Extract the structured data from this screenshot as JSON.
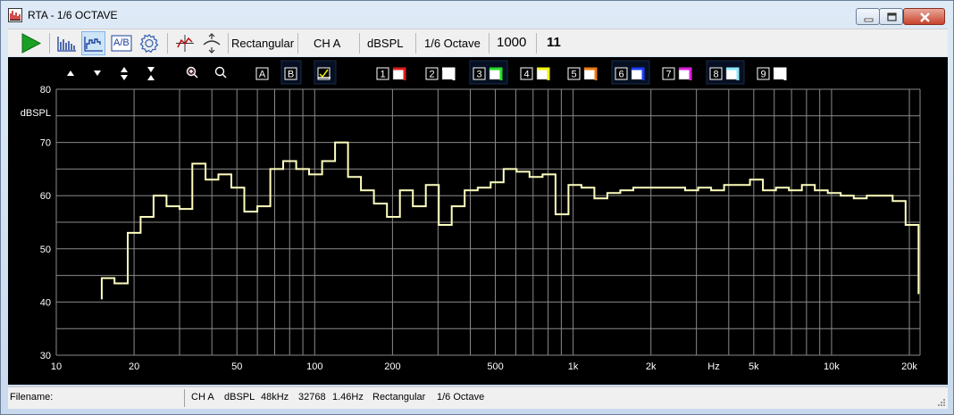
{
  "window": {
    "title": "RTA - 1/6 OCTAVE"
  },
  "toolbar": {
    "icons": [
      "play-icon",
      "bar-graph-icon",
      "line-graph-icon",
      "ab-compare-icon",
      "gear-icon",
      "cursor-icon",
      "cursor-track-icon"
    ],
    "ab_label": "A/B",
    "window_type": "Rectangular",
    "channel": "CH A",
    "units": "dBSPL",
    "resolution": "1/6 Octave",
    "averages": "1000",
    "count": "11"
  },
  "graph_controls": {
    "nav_icons": [
      "arrow-up-icon",
      "arrow-down-icon",
      "expand-vertical-icon",
      "collapse-vertical-icon",
      "zoom-in-icon",
      "zoom-out-icon"
    ],
    "trace_a": "A",
    "trace_b": "B",
    "memories": [
      {
        "num": "1",
        "color": "#e11b1b"
      },
      {
        "num": "2",
        "color": "#ffffff"
      },
      {
        "num": "3",
        "color": "#22e022"
      },
      {
        "num": "4",
        "color": "#f2f20c"
      },
      {
        "num": "5",
        "color": "#f07a10"
      },
      {
        "num": "6",
        "color": "#1c3cff"
      },
      {
        "num": "7",
        "color": "#e01ee0"
      },
      {
        "num": "8",
        "color": "#8de8f8"
      },
      {
        "num": "9",
        "color": "#ffffff"
      }
    ]
  },
  "chart_data": {
    "type": "line",
    "ylabel": "dBSPL",
    "xunit": "Hz",
    "xscale": "log",
    "xlim": [
      10,
      22000
    ],
    "ylim": [
      30,
      80
    ],
    "y_ticks": [
      30,
      40,
      50,
      60,
      70,
      80
    ],
    "x_tick_labels": [
      {
        "v": 10,
        "t": "10"
      },
      {
        "v": 20,
        "t": "20"
      },
      {
        "v": 50,
        "t": "50"
      },
      {
        "v": 100,
        "t": "100"
      },
      {
        "v": 200,
        "t": "200"
      },
      {
        "v": 500,
        "t": "500"
      },
      {
        "v": 1000,
        "t": "1k"
      },
      {
        "v": 2000,
        "t": "2k"
      },
      {
        "v": 5000,
        "t": "5k"
      },
      {
        "v": 10000,
        "t": "10k"
      },
      {
        "v": 20000,
        "t": "20k"
      }
    ],
    "x_unit_label_at": 3500,
    "grid": true,
    "line_color": "#ffffc0",
    "series": [
      {
        "bin_edges": [
          15.0,
          16.8,
          18.9,
          21.2,
          23.8,
          26.7,
          30.0,
          33.6,
          37.8,
          42.4,
          47.6,
          53.4,
          60.0,
          67.3,
          75.5,
          84.8,
          95.1,
          106.8,
          119.9,
          134.5,
          151.0,
          169.5,
          190.3,
          213.6,
          239.8,
          269.2,
          302.1,
          339.1,
          380.6,
          427.2,
          479.5,
          538.3,
          604.2,
          678.2,
          761.3,
          854.5,
          959.2,
          1076.6,
          1208.5,
          1356.5,
          1522.6,
          1709.1,
          1918.4,
          2153.4,
          2417.1,
          2713.2,
          3045.5,
          3418.5,
          3837.2,
          4307.1,
          4834.6,
          5426.8,
          6091.5,
          6837.5,
          7674.9,
          8615.0,
          9670.0,
          10854.3,
          12183.8,
          13676.0,
          15351.0,
          17231.2,
          19341.6,
          21710.5
        ],
        "values": [
          44.5,
          43.5,
          53.0,
          56.0,
          60.0,
          58.0,
          57.5,
          66.0,
          63.0,
          64.0,
          61.5,
          57.0,
          58.0,
          65.0,
          66.5,
          65.0,
          64.0,
          66.5,
          70.0,
          63.5,
          61.0,
          58.5,
          56.0,
          61.0,
          58.0,
          62.0,
          54.5,
          58.0,
          61.0,
          61.5,
          62.5,
          65.0,
          64.5,
          63.5,
          64.0,
          56.5,
          62.0,
          61.5,
          59.5,
          60.5,
          61.0,
          61.5,
          61.5,
          61.5,
          61.5,
          61.0,
          61.5,
          61.0,
          62.0,
          62.0,
          63.0,
          61.0,
          61.5,
          61.0,
          62.0,
          61.0,
          60.5,
          60.0,
          59.5,
          60.0,
          60.0,
          59.0,
          54.5,
          41.5
        ],
        "start_value": 40.5
      }
    ]
  },
  "statusbar": {
    "filename_label": "Filename:",
    "channel": "CH A",
    "units": "dBSPL",
    "sample_rate": "48kHz",
    "fft_size": "32768",
    "bin_resolution": "1.46Hz",
    "window_type": "Rectangular",
    "resolution": "1/6 Octave"
  }
}
